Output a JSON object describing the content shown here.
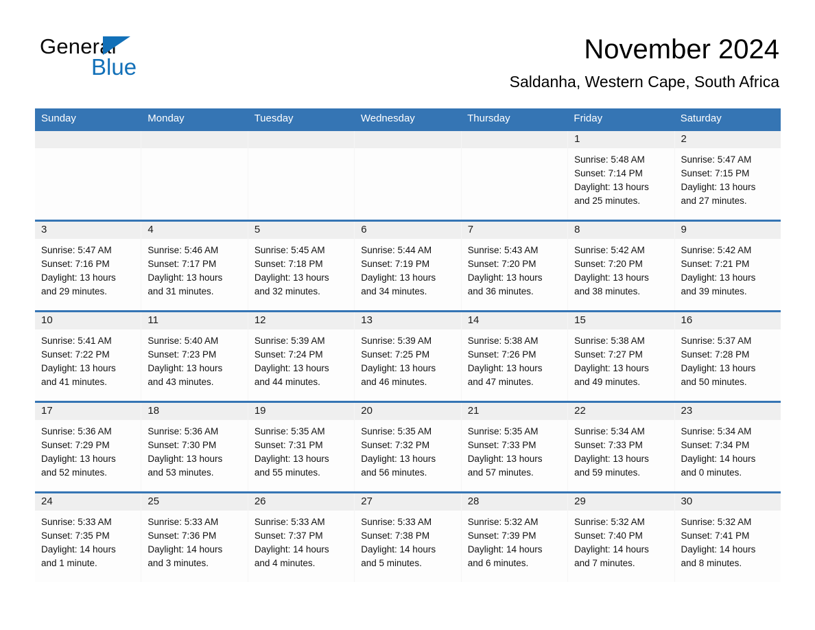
{
  "logo": {
    "text_general": "General",
    "text_blue": "Blue",
    "triangle_color": "#1270b8"
  },
  "header": {
    "title": "November 2024",
    "subtitle": "Saldanha, Western Cape, South Africa"
  },
  "colors": {
    "header_blue": "#3575b4",
    "date_band_gray": "#efefef",
    "cell_background": "#fdfdfd",
    "text": "#111111"
  },
  "weekdays": [
    "Sunday",
    "Monday",
    "Tuesday",
    "Wednesday",
    "Thursday",
    "Friday",
    "Saturday"
  ],
  "weeks": [
    [
      {
        "date": "",
        "lines": []
      },
      {
        "date": "",
        "lines": []
      },
      {
        "date": "",
        "lines": []
      },
      {
        "date": "",
        "lines": []
      },
      {
        "date": "",
        "lines": []
      },
      {
        "date": "1",
        "lines": [
          "Sunrise: 5:48 AM",
          "Sunset: 7:14 PM",
          "Daylight: 13 hours",
          "and 25 minutes."
        ]
      },
      {
        "date": "2",
        "lines": [
          "Sunrise: 5:47 AM",
          "Sunset: 7:15 PM",
          "Daylight: 13 hours",
          "and 27 minutes."
        ]
      }
    ],
    [
      {
        "date": "3",
        "lines": [
          "Sunrise: 5:47 AM",
          "Sunset: 7:16 PM",
          "Daylight: 13 hours",
          "and 29 minutes."
        ]
      },
      {
        "date": "4",
        "lines": [
          "Sunrise: 5:46 AM",
          "Sunset: 7:17 PM",
          "Daylight: 13 hours",
          "and 31 minutes."
        ]
      },
      {
        "date": "5",
        "lines": [
          "Sunrise: 5:45 AM",
          "Sunset: 7:18 PM",
          "Daylight: 13 hours",
          "and 32 minutes."
        ]
      },
      {
        "date": "6",
        "lines": [
          "Sunrise: 5:44 AM",
          "Sunset: 7:19 PM",
          "Daylight: 13 hours",
          "and 34 minutes."
        ]
      },
      {
        "date": "7",
        "lines": [
          "Sunrise: 5:43 AM",
          "Sunset: 7:20 PM",
          "Daylight: 13 hours",
          "and 36 minutes."
        ]
      },
      {
        "date": "8",
        "lines": [
          "Sunrise: 5:42 AM",
          "Sunset: 7:20 PM",
          "Daylight: 13 hours",
          "and 38 minutes."
        ]
      },
      {
        "date": "9",
        "lines": [
          "Sunrise: 5:42 AM",
          "Sunset: 7:21 PM",
          "Daylight: 13 hours",
          "and 39 minutes."
        ]
      }
    ],
    [
      {
        "date": "10",
        "lines": [
          "Sunrise: 5:41 AM",
          "Sunset: 7:22 PM",
          "Daylight: 13 hours",
          "and 41 minutes."
        ]
      },
      {
        "date": "11",
        "lines": [
          "Sunrise: 5:40 AM",
          "Sunset: 7:23 PM",
          "Daylight: 13 hours",
          "and 43 minutes."
        ]
      },
      {
        "date": "12",
        "lines": [
          "Sunrise: 5:39 AM",
          "Sunset: 7:24 PM",
          "Daylight: 13 hours",
          "and 44 minutes."
        ]
      },
      {
        "date": "13",
        "lines": [
          "Sunrise: 5:39 AM",
          "Sunset: 7:25 PM",
          "Daylight: 13 hours",
          "and 46 minutes."
        ]
      },
      {
        "date": "14",
        "lines": [
          "Sunrise: 5:38 AM",
          "Sunset: 7:26 PM",
          "Daylight: 13 hours",
          "and 47 minutes."
        ]
      },
      {
        "date": "15",
        "lines": [
          "Sunrise: 5:38 AM",
          "Sunset: 7:27 PM",
          "Daylight: 13 hours",
          "and 49 minutes."
        ]
      },
      {
        "date": "16",
        "lines": [
          "Sunrise: 5:37 AM",
          "Sunset: 7:28 PM",
          "Daylight: 13 hours",
          "and 50 minutes."
        ]
      }
    ],
    [
      {
        "date": "17",
        "lines": [
          "Sunrise: 5:36 AM",
          "Sunset: 7:29 PM",
          "Daylight: 13 hours",
          "and 52 minutes."
        ]
      },
      {
        "date": "18",
        "lines": [
          "Sunrise: 5:36 AM",
          "Sunset: 7:30 PM",
          "Daylight: 13 hours",
          "and 53 minutes."
        ]
      },
      {
        "date": "19",
        "lines": [
          "Sunrise: 5:35 AM",
          "Sunset: 7:31 PM",
          "Daylight: 13 hours",
          "and 55 minutes."
        ]
      },
      {
        "date": "20",
        "lines": [
          "Sunrise: 5:35 AM",
          "Sunset: 7:32 PM",
          "Daylight: 13 hours",
          "and 56 minutes."
        ]
      },
      {
        "date": "21",
        "lines": [
          "Sunrise: 5:35 AM",
          "Sunset: 7:33 PM",
          "Daylight: 13 hours",
          "and 57 minutes."
        ]
      },
      {
        "date": "22",
        "lines": [
          "Sunrise: 5:34 AM",
          "Sunset: 7:33 PM",
          "Daylight: 13 hours",
          "and 59 minutes."
        ]
      },
      {
        "date": "23",
        "lines": [
          "Sunrise: 5:34 AM",
          "Sunset: 7:34 PM",
          "Daylight: 14 hours",
          "and 0 minutes."
        ]
      }
    ],
    [
      {
        "date": "24",
        "lines": [
          "Sunrise: 5:33 AM",
          "Sunset: 7:35 PM",
          "Daylight: 14 hours",
          "and 1 minute."
        ]
      },
      {
        "date": "25",
        "lines": [
          "Sunrise: 5:33 AM",
          "Sunset: 7:36 PM",
          "Daylight: 14 hours",
          "and 3 minutes."
        ]
      },
      {
        "date": "26",
        "lines": [
          "Sunrise: 5:33 AM",
          "Sunset: 7:37 PM",
          "Daylight: 14 hours",
          "and 4 minutes."
        ]
      },
      {
        "date": "27",
        "lines": [
          "Sunrise: 5:33 AM",
          "Sunset: 7:38 PM",
          "Daylight: 14 hours",
          "and 5 minutes."
        ]
      },
      {
        "date": "28",
        "lines": [
          "Sunrise: 5:32 AM",
          "Sunset: 7:39 PM",
          "Daylight: 14 hours",
          "and 6 minutes."
        ]
      },
      {
        "date": "29",
        "lines": [
          "Sunrise: 5:32 AM",
          "Sunset: 7:40 PM",
          "Daylight: 14 hours",
          "and 7 minutes."
        ]
      },
      {
        "date": "30",
        "lines": [
          "Sunrise: 5:32 AM",
          "Sunset: 7:41 PM",
          "Daylight: 14 hours",
          "and 8 minutes."
        ]
      }
    ]
  ]
}
